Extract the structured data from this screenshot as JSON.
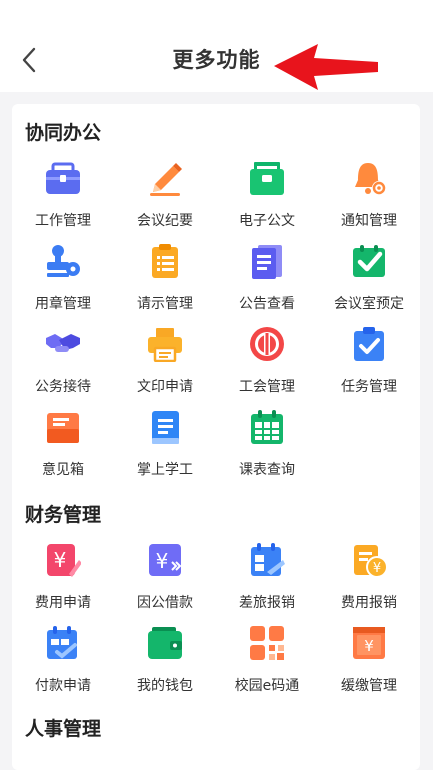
{
  "header": {
    "title": "更多功能"
  },
  "sections": [
    {
      "title": "协同办公",
      "items": [
        {
          "label": "工作管理",
          "icon": "briefcase-icon"
        },
        {
          "label": "会议纪要",
          "icon": "pen-icon"
        },
        {
          "label": "电子公文",
          "icon": "folder-icon"
        },
        {
          "label": "通知管理",
          "icon": "bell-icon"
        },
        {
          "label": "用章管理",
          "icon": "stamp-icon"
        },
        {
          "label": "请示管理",
          "icon": "clipboard-icon"
        },
        {
          "label": "公告查看",
          "icon": "document-icon"
        },
        {
          "label": "会议室预定",
          "icon": "check-board-icon"
        },
        {
          "label": "公务接待",
          "icon": "handshake-icon"
        },
        {
          "label": "文印申请",
          "icon": "printer-icon"
        },
        {
          "label": "工会管理",
          "icon": "union-badge-icon"
        },
        {
          "label": "任务管理",
          "icon": "task-check-icon"
        },
        {
          "label": "意见箱",
          "icon": "mailbox-icon"
        },
        {
          "label": "掌上学工",
          "icon": "book-icon"
        },
        {
          "label": "课表查询",
          "icon": "calendar-icon"
        }
      ]
    },
    {
      "title": "财务管理",
      "items": [
        {
          "label": "费用申请",
          "icon": "yuan-pen-icon"
        },
        {
          "label": "因公借款",
          "icon": "yuan-arrow-icon"
        },
        {
          "label": "差旅报销",
          "icon": "travel-calendar-icon"
        },
        {
          "label": "费用报销",
          "icon": "reimburse-coin-icon"
        },
        {
          "label": "付款申请",
          "icon": "payment-calendar-icon"
        },
        {
          "label": "我的钱包",
          "icon": "wallet-icon"
        },
        {
          "label": "校园e码通",
          "icon": "qr-code-icon"
        },
        {
          "label": "缓缴管理",
          "icon": "deferral-box-icon"
        }
      ]
    },
    {
      "title": "人事管理",
      "items": []
    }
  ]
}
